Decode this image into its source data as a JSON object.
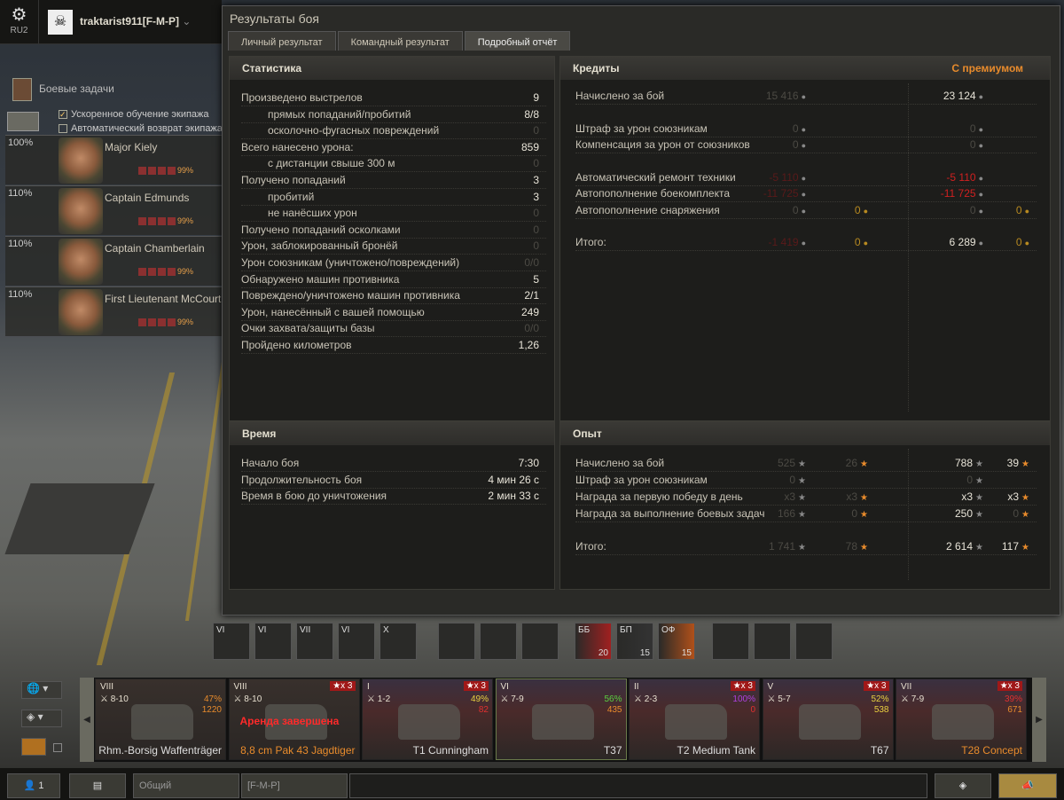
{
  "header": {
    "server": "RU2",
    "username": "traktarist911[F-M-P]",
    "settings_icon": "gear-icon"
  },
  "quests": {
    "label": "Боевые задачи",
    "accelerated_training": "Ускоренное обучение экипажа",
    "auto_return": "Автоматический возврат экипажа",
    "accelerated_checked": true,
    "auto_return_checked": false
  },
  "crew": [
    {
      "name": "Major Kiely",
      "level": "100%",
      "skill": "99%"
    },
    {
      "name": "Captain Edmunds",
      "level": "110%",
      "skill": "99%"
    },
    {
      "name": "Captain Chamberlain",
      "level": "110%",
      "skill": "99%"
    },
    {
      "name": "First Lieutenant McCourt",
      "level": "110%",
      "skill": "99%"
    }
  ],
  "window": {
    "title": "Результаты боя",
    "tabs": [
      "Личный результат",
      "Командный результат",
      "Подробный отчёт"
    ],
    "active_tab": 2
  },
  "stats": {
    "title": "Статистика",
    "rows": [
      {
        "label": "Произведено выстрелов",
        "value": "9",
        "indent": false,
        "dim": false
      },
      {
        "label": "прямых попаданий/пробитий",
        "value": "8/8",
        "indent": true,
        "dim": false
      },
      {
        "label": "осколочно-фугасных повреждений",
        "value": "0",
        "indent": true,
        "dim": true
      },
      {
        "label": "Всего нанесено урона:",
        "value": "859",
        "indent": false,
        "dim": false
      },
      {
        "label": "с дистанции свыше 300 м",
        "value": "0",
        "indent": true,
        "dim": true
      },
      {
        "label": "Получено попаданий",
        "value": "3",
        "indent": false,
        "dim": false
      },
      {
        "label": "пробитий",
        "value": "3",
        "indent": true,
        "dim": false
      },
      {
        "label": "не нанёсших урон",
        "value": "0",
        "indent": true,
        "dim": true
      },
      {
        "label": "Получено попаданий осколками",
        "value": "0",
        "indent": false,
        "dim": true
      },
      {
        "label": "Урон, заблокированный бронёй",
        "value": "0",
        "indent": false,
        "dim": true
      },
      {
        "label": "Урон союзникам (уничтожено/повреждений)",
        "value": "0/0",
        "indent": false,
        "dim": true
      },
      {
        "label": "Обнаружено машин противника",
        "value": "5",
        "indent": false,
        "dim": false
      },
      {
        "label": "Повреждено/уничтожено машин противника",
        "value": "2/1",
        "indent": false,
        "dim": false
      },
      {
        "label": "Урон, нанесённый с вашей помощью",
        "value": "249",
        "indent": false,
        "dim": false
      },
      {
        "label": "Очки захвата/защиты базы",
        "value": "0/0",
        "indent": false,
        "dim": true
      },
      {
        "label": "Пройдено километров",
        "value": "1,26",
        "indent": false,
        "dim": false
      }
    ]
  },
  "credits": {
    "title": "Кредиты",
    "premium_label": "С премиумом",
    "rows": [
      {
        "label": "Начислено за бой",
        "base": "15 416",
        "base_gold": "",
        "prem": "23 124",
        "prem_gold": "",
        "gap": false,
        "type": "normal"
      },
      {
        "label": "Штраф за урон союзникам",
        "base": "0",
        "base_gold": "",
        "prem": "0",
        "prem_gold": "",
        "gap": true,
        "type": "dim"
      },
      {
        "label": "Компенсация за урон от союзников",
        "base": "0",
        "base_gold": "",
        "prem": "0",
        "prem_gold": "",
        "gap": false,
        "type": "dim"
      },
      {
        "label": "Автоматический ремонт техники",
        "base": "-5 110",
        "base_gold": "",
        "prem": "-5 110",
        "prem_gold": "",
        "gap": true,
        "type": "red"
      },
      {
        "label": "Автопополнение боекомплекта",
        "base": "-11 725",
        "base_gold": "",
        "prem": "-11 725",
        "prem_gold": "",
        "gap": false,
        "type": "red"
      },
      {
        "label": "Автопополнение снаряжения",
        "base": "0",
        "base_gold": "0",
        "prem": "0",
        "prem_gold": "0",
        "gap": false,
        "type": "dim"
      },
      {
        "label": "Итого:",
        "base": "-1 419",
        "base_gold": "0",
        "prem": "6 289",
        "prem_gold": "0",
        "gap": true,
        "type": "total"
      }
    ]
  },
  "time": {
    "title": "Время",
    "rows": [
      {
        "label": "Начало боя",
        "value": "7:30"
      },
      {
        "label": "Продолжительность боя",
        "value": "4 мин 26 с"
      },
      {
        "label": "Время в бою до уничтожения",
        "value": "2 мин 33 с"
      }
    ]
  },
  "xp": {
    "title": "Опыт",
    "rows": [
      {
        "label": "Начислено за бой",
        "base": "525",
        "base_free": "26",
        "prem": "788",
        "prem_free": "39",
        "gap": false,
        "prem_dim": false,
        "prem_free_dim": false
      },
      {
        "label": "Штраф за урон союзникам",
        "base": "0",
        "base_free": "",
        "prem": "0",
        "prem_free": "",
        "gap": false,
        "prem_dim": true,
        "prem_free_dim": true
      },
      {
        "label": "Награда за первую победу в день",
        "base": "x3",
        "base_free": "x3",
        "prem": "x3",
        "prem_free": "x3",
        "gap": false,
        "prem_dim": false,
        "prem_free_dim": false
      },
      {
        "label": "Награда за выполнение боевых задач",
        "base": "166",
        "base_free": "0",
        "prem": "250",
        "prem_free": "0",
        "gap": false,
        "prem_dim": false,
        "prem_free_dim": true
      },
      {
        "label": "Итого:",
        "base": "1 741",
        "base_free": "78",
        "prem": "2 614",
        "prem_free": "117",
        "gap": true,
        "prem_dim": false,
        "prem_free_dim": false
      }
    ]
  },
  "modules": [
    {
      "tier": "VI",
      "name": "gun-icon"
    },
    {
      "tier": "VI",
      "name": "turret-icon"
    },
    {
      "tier": "VII",
      "name": "engine-icon"
    },
    {
      "tier": "VI",
      "name": "suspension-icon"
    },
    {
      "tier": "X",
      "name": "radio-icon"
    }
  ],
  "equipment": [
    "rammer-icon",
    "vertical-stabilizer-icon",
    "camo-net-icon"
  ],
  "ammo": [
    {
      "type": "ББ",
      "count": "20",
      "color": "#a02020"
    },
    {
      "type": "БП",
      "count": "15",
      "color": "#333"
    },
    {
      "type": "ОФ",
      "count": "15",
      "color": "#b0501a"
    }
  ],
  "consumables": [
    "first-aid-kit-icon",
    "repair-kit-icon",
    "fire-extinguisher-icon"
  ],
  "tanks": [
    {
      "tier": "VIII",
      "levels": "8-10",
      "x3": "",
      "winrate": "47%",
      "wr_color": "#e88b2c",
      "battles": "1220",
      "bt_color": "#e88b2c",
      "name": "Rhm.-Borsig Waffenträger",
      "name_color": "#ddd",
      "rent": "",
      "usa": false
    },
    {
      "tier": "VIII",
      "levels": "8-10",
      "x3": "x 3",
      "winrate": "",
      "wr_color": "",
      "battles": "",
      "bt_color": "",
      "name": "8,8 cm Pak 43 Jagdtiger",
      "name_color": "#e88b2c",
      "rent": "Аренда завершена",
      "usa": false
    },
    {
      "tier": "I",
      "levels": "1-2",
      "x3": "x 3",
      "winrate": "49%",
      "wr_color": "#e8d040",
      "battles": "82",
      "bt_color": "#e03030",
      "name": "T1 Cunningham",
      "name_color": "#ddd",
      "rent": "",
      "usa": true
    },
    {
      "tier": "VI",
      "levels": "7-9",
      "x3": "",
      "winrate": "56%",
      "wr_color": "#5ad040",
      "battles": "435",
      "bt_color": "#e88b2c",
      "name": "T37",
      "name_color": "#ddd",
      "rent": "",
      "usa": true
    },
    {
      "tier": "II",
      "levels": "2-3",
      "x3": "x 3",
      "winrate": "100%",
      "wr_color": "#b040e0",
      "battles": "0",
      "bt_color": "#e03030",
      "name": "T2 Medium Tank",
      "name_color": "#ddd",
      "rent": "",
      "usa": true
    },
    {
      "tier": "V",
      "levels": "5-7",
      "x3": "x 3",
      "winrate": "52%",
      "wr_color": "#e8d040",
      "battles": "538",
      "bt_color": "#e8d040",
      "name": "T67",
      "name_color": "#ddd",
      "rent": "",
      "usa": true
    },
    {
      "tier": "VII",
      "levels": "7-9",
      "x3": "x 3",
      "winrate": "39%",
      "wr_color": "#e03030",
      "battles": "671",
      "bt_color": "#e88b2c",
      "name": "T28 Concept",
      "name_color": "#e88b2c",
      "rent": "",
      "usa": true
    }
  ],
  "bottom": {
    "online": "1",
    "chat_channel": "Общий",
    "clan_channel": "[F-M-P]"
  }
}
